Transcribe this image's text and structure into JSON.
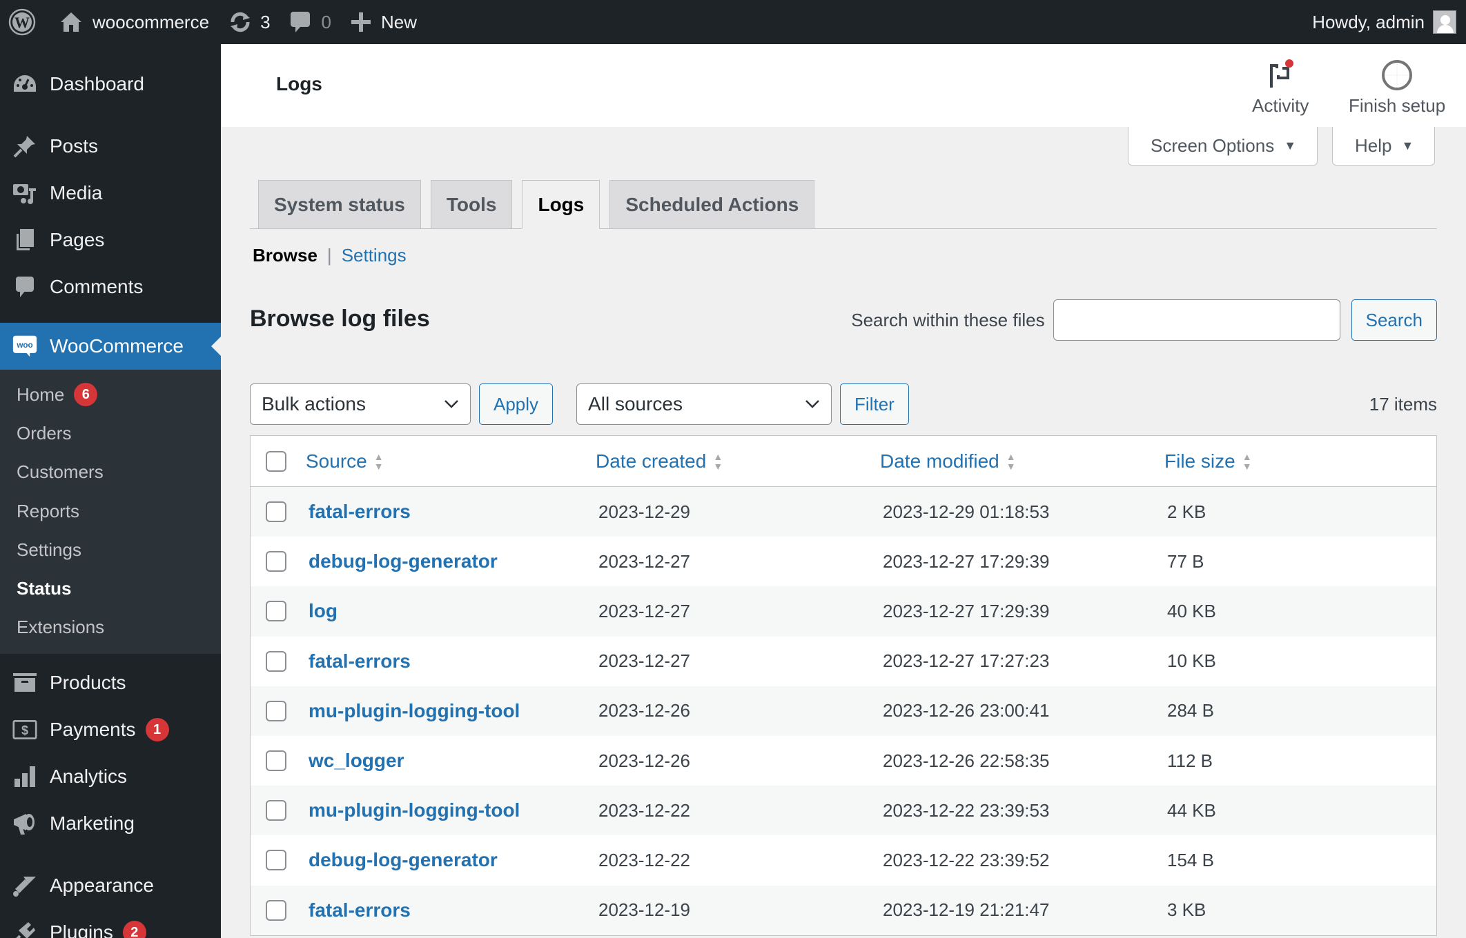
{
  "adminbar": {
    "site_name": "woocommerce",
    "updates_count": "3",
    "comments_count": "0",
    "new_label": "New",
    "howdy": "Howdy, admin"
  },
  "sidebar": {
    "top_items": [
      {
        "label": "Dashboard",
        "icon": "dashboard-icon"
      },
      {
        "label": "Posts",
        "icon": "pin-icon"
      },
      {
        "label": "Media",
        "icon": "media-icon"
      },
      {
        "label": "Pages",
        "icon": "pages-icon"
      },
      {
        "label": "Comments",
        "icon": "comment-icon"
      }
    ],
    "woocommerce": {
      "label": "WooCommerce",
      "icon_text": "woo"
    },
    "woo_submenu": [
      {
        "label": "Home",
        "badge": "6"
      },
      {
        "label": "Orders"
      },
      {
        "label": "Customers"
      },
      {
        "label": "Reports"
      },
      {
        "label": "Settings"
      },
      {
        "label": "Status",
        "current": true
      },
      {
        "label": "Extensions"
      }
    ],
    "bottom_items": [
      {
        "label": "Products",
        "icon": "archive-icon"
      },
      {
        "label": "Payments",
        "icon": "money-icon",
        "badge": "1"
      },
      {
        "label": "Analytics",
        "icon": "bar-chart-icon"
      },
      {
        "label": "Marketing",
        "icon": "megaphone-icon"
      },
      {
        "label": "Appearance",
        "icon": "paintbrush-icon"
      },
      {
        "label": "Plugins",
        "icon": "plugin-icon",
        "badge": "2"
      }
    ]
  },
  "header": {
    "title": "Logs",
    "activity_label": "Activity",
    "finish_setup_label": "Finish setup"
  },
  "screen_meta": {
    "screen_options": "Screen Options",
    "help": "Help"
  },
  "tabs": [
    {
      "label": "System status",
      "active": false
    },
    {
      "label": "Tools",
      "active": false
    },
    {
      "label": "Logs",
      "active": true
    },
    {
      "label": "Scheduled Actions",
      "active": false
    }
  ],
  "subnav": {
    "browse": "Browse",
    "separator": "|",
    "settings": "Settings"
  },
  "main": {
    "heading": "Browse log files",
    "search_label": "Search within these files",
    "search_value": "",
    "search_button": "Search",
    "bulk_actions": "Bulk actions",
    "apply": "Apply",
    "sources": "All sources",
    "filter": "Filter",
    "item_count": "17 items"
  },
  "table": {
    "columns": [
      "Source",
      "Date created",
      "Date modified",
      "File size"
    ],
    "rows": [
      {
        "source": "fatal-errors",
        "created": "2023-12-29",
        "modified": "2023-12-29 01:18:53",
        "size": "2 KB"
      },
      {
        "source": "debug-log-generator",
        "created": "2023-12-27",
        "modified": "2023-12-27 17:29:39",
        "size": "77 B"
      },
      {
        "source": "log",
        "created": "2023-12-27",
        "modified": "2023-12-27 17:29:39",
        "size": "40 KB"
      },
      {
        "source": "fatal-errors",
        "created": "2023-12-27",
        "modified": "2023-12-27 17:27:23",
        "size": "10 KB"
      },
      {
        "source": "mu-plugin-logging-tool",
        "created": "2023-12-26",
        "modified": "2023-12-26 23:00:41",
        "size": "284 B"
      },
      {
        "source": "wc_logger",
        "created": "2023-12-26",
        "modified": "2023-12-26 22:58:35",
        "size": "112 B"
      },
      {
        "source": "mu-plugin-logging-tool",
        "created": "2023-12-22",
        "modified": "2023-12-22 23:39:53",
        "size": "44 KB"
      },
      {
        "source": "debug-log-generator",
        "created": "2023-12-22",
        "modified": "2023-12-22 23:39:52",
        "size": "154 B"
      },
      {
        "source": "fatal-errors",
        "created": "2023-12-19",
        "modified": "2023-12-19 21:21:47",
        "size": "3 KB"
      }
    ]
  },
  "colors": {
    "adminbar_bg": "#1d2327",
    "accent": "#2271b1",
    "badge": "#d63638",
    "submenu_bg": "#2c3338"
  }
}
